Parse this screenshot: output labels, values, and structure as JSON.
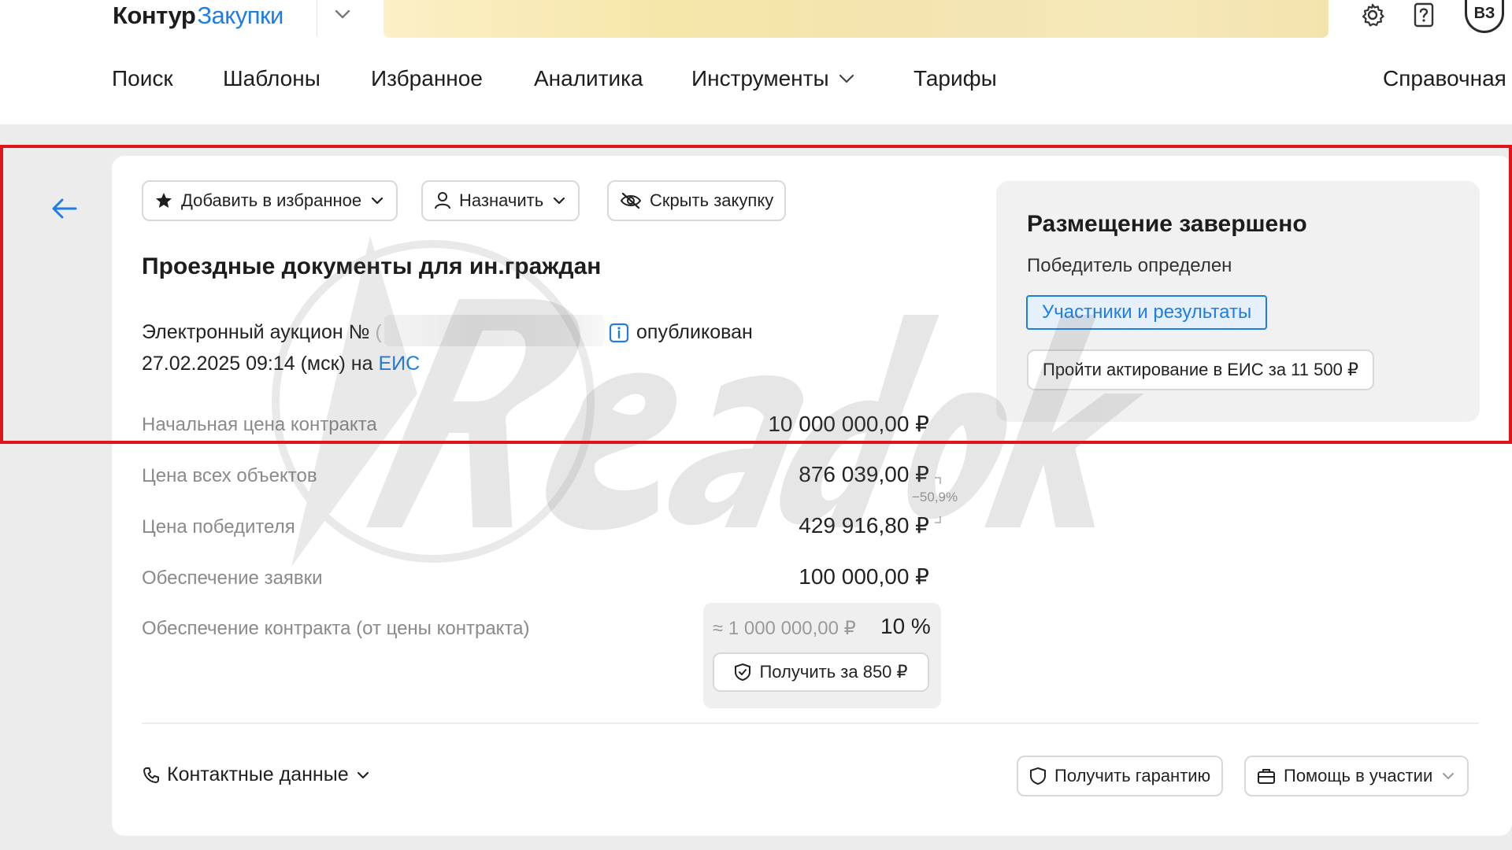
{
  "header": {
    "logo_part1": "Контур",
    "logo_part2": "Закупки",
    "avatar_initials": "ВЗ",
    "icons": [
      "gear-icon",
      "help-icon"
    ]
  },
  "nav": {
    "items": [
      {
        "label": "Поиск"
      },
      {
        "label": "Шаблоны"
      },
      {
        "label": "Избранное"
      },
      {
        "label": "Аналитика"
      },
      {
        "label": "Инструменты"
      },
      {
        "label": "Тарифы"
      },
      {
        "label": "Справочная"
      }
    ]
  },
  "actions": {
    "favorite": "Добавить в избранное",
    "assign": "Назначить",
    "hide": "Скрыть закупку"
  },
  "purchase": {
    "title": "Проездные документы для ин.граждан",
    "auction_prefix": "Электронный аукцион №",
    "auction_number_open": "(",
    "status": "опубликован",
    "date": "27.02.2025 09:14 (мск) на ",
    "platform_link": "ЕИС"
  },
  "prices": {
    "rows": [
      {
        "label": "Начальная цена контракта",
        "value": "10 000 000,00 ₽"
      },
      {
        "label": "Цена всех объектов",
        "value": "876 039,00 ₽"
      },
      {
        "label": "Цена победителя",
        "value": "429 916,80 ₽"
      },
      {
        "label": "Обеспечение заявки",
        "value": "100 000,00 ₽"
      },
      {
        "label": "Обеспечение контракта (от цены контракта)",
        "value": ""
      }
    ],
    "diff_note": "−50,9%",
    "contract_security_approx": "≈ 1 000 000,00 ₽",
    "contract_security_percent": "10 %",
    "get_guarantee_price": "Получить за 850 ₽"
  },
  "status_panel": {
    "title": "Размещение завершено",
    "subtitle": "Победитель определен",
    "results_button": "Участники и результаты",
    "eis_button": "Пройти актирование в ЕИС за 11 500 ₽"
  },
  "footer": {
    "contacts": "Контактные данные",
    "get_guarantee": "Получить гарантию",
    "help_participation": "Помощь в участии"
  },
  "colors": {
    "accent": "#1e7de6",
    "highlight_frame": "#e0141b",
    "banner": "#f7e6aa"
  }
}
